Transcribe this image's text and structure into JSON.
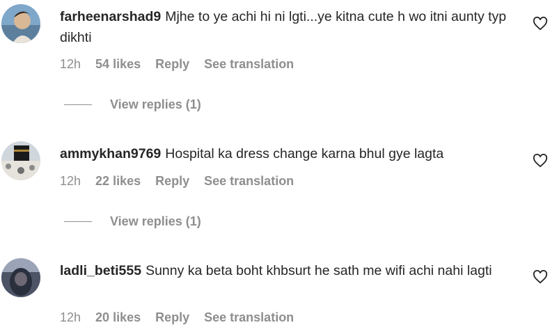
{
  "comments": [
    {
      "username": "farheenarshad9",
      "text": "Mjhe to ye achi hi ni lgti...ye kitna cute h wo itni aunty typ dikhti",
      "time": "12h",
      "likes": "54 likes",
      "reply": "Reply",
      "translate": "See translation",
      "view_replies": "View replies (1)"
    },
    {
      "username": "ammykhan9769",
      "text": "Hospital ka dress change karna bhul gye lagta",
      "time": "12h",
      "likes": "22 likes",
      "reply": "Reply",
      "translate": "See translation",
      "view_replies": "View replies (1)"
    },
    {
      "username": "ladli_beti555",
      "text": "Sunny ka beta boht khbsurt he sath me wifi achi nahi lagti",
      "time": "12h",
      "likes": "20 likes",
      "reply": "Reply",
      "translate": "See translation"
    }
  ],
  "icons": {
    "like": "heart-outline-icon"
  },
  "colors": {
    "text": "#262626",
    "secondary": "#8e8e8e"
  }
}
